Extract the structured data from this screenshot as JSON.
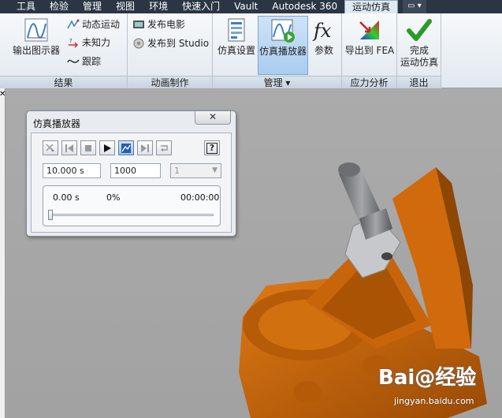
{
  "menu_tabs": [
    "工具",
    "检验",
    "管理",
    "视图",
    "环境",
    "快速入门",
    "Vault",
    "Autodesk 360",
    "运动仿真"
  ],
  "menu_toggle": "▭ ▾",
  "ribbon": {
    "results_panel": {
      "title": "结果",
      "output_plotter": "输出图示器",
      "dynamic_motion": "动态运动",
      "unknown_force": "未知力",
      "trace": "跟踪"
    },
    "animation_panel": {
      "title": "动画制作",
      "publish_movie": "发布电影",
      "publish_studio": "发布到 Studio"
    },
    "manage_panel": {
      "title": "管理 ▾",
      "sim_settings": "仿真设置",
      "sim_player": "仿真播放器",
      "parameters": "参数"
    },
    "stress_panel": {
      "title": "应力分析",
      "export_fea": "导出到 FEA"
    },
    "exit_panel": {
      "title": "退出",
      "finish_line1": "完成",
      "finish_line2": "运动仿真"
    }
  },
  "player": {
    "title": "仿真播放器",
    "close_glyph": "✕",
    "end_time": "10.000 s",
    "steps": "1000",
    "repeat_count": "1",
    "current_time": "0.00 s",
    "percent": "0%",
    "clock": "00:00:00",
    "progress": 0,
    "help_glyph": "?"
  },
  "left_close": "✕",
  "watermark": {
    "brand": "Bai@经验",
    "url": "jingyan.baidu.com"
  },
  "colors": {
    "menubar": "#2b3544",
    "model_orange": "#c8650a",
    "shaft_gray": "#8a8c90",
    "accent_blue": "#3a7fc8"
  }
}
